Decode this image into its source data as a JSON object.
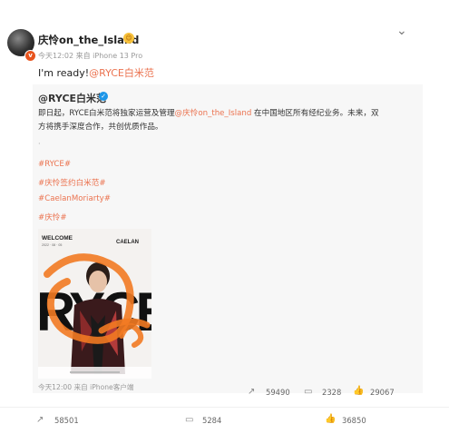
{
  "post": {
    "author_name": "庆怜on_the_Island",
    "author_emoji": "😉",
    "avatar_badge": "v",
    "timestamp": "今天12:02",
    "source_prefix": "来自",
    "source_device": "iPhone 13 Pro",
    "text_prefix": "I'm ready!",
    "text_mention": "@RYCE白米范"
  },
  "repost": {
    "author": "@RYCE白米范",
    "verified_mark": "✓",
    "body_line1_a": "即日起，RYCE白米范将独家运营及管理",
    "body_mention": "@庆怜on_the_Island",
    "body_line1_b": " 在中国地区所有经纪业务。未来，双",
    "body_line2": "方将携手深度合作，共创优质作品。",
    "dot": "·",
    "tags": [
      "#RYCE#",
      "#庆怜签约白米范#",
      "#CaelanMoriarty#",
      "#庆怜#"
    ],
    "poster": {
      "welcome": "WELCOME",
      "date": "2022 · 08 · 05",
      "name": "CAELAN",
      "big_text": "RYCE"
    },
    "meta": "今天12:00 来自 iPhone客户端",
    "stats": {
      "reposts": "59490",
      "comments": "2328",
      "likes": "29067"
    }
  },
  "footer": {
    "reposts": "58501",
    "comments": "5284",
    "likes": "36850"
  },
  "icons": {
    "chevron": "chevron-down-icon",
    "repost": "repost-icon",
    "comment": "comment-icon",
    "like": "like-icon"
  },
  "colors": {
    "link": "#eb7350",
    "verified": "#1e96e8",
    "badge": "#e8541e"
  }
}
